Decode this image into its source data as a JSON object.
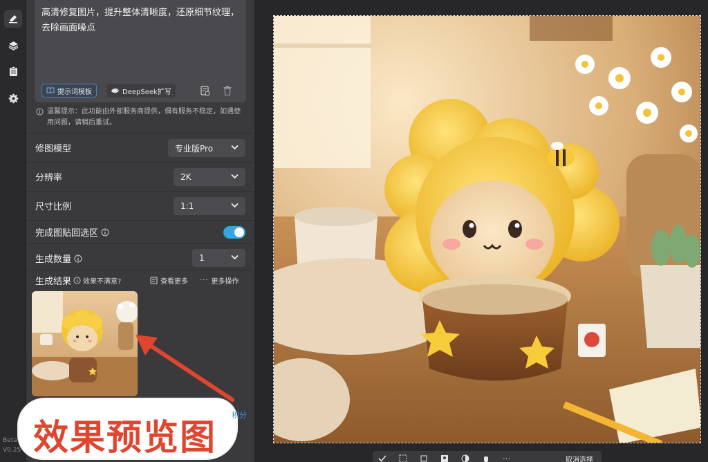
{
  "sidebar_rail": {
    "meta_line1": "Beta",
    "meta_line2": "V0.25"
  },
  "prompt": {
    "text": "高清修复图片，提升整体清晰度，还原细节纹理，去除画面噪点",
    "template_button": "提示词模板",
    "deepseek_button": "DeepSeek扩写"
  },
  "tip": "温馨提示：此功能由外部服务商提供，偶有服务不稳定，如遇使用问题，请稍后重试。",
  "settings": {
    "model": {
      "label": "修图模型",
      "value": "专业版Pro"
    },
    "resolution": {
      "label": "分辨率",
      "value": "2K"
    },
    "ratio": {
      "label": "尺寸比例",
      "value": "1:1"
    },
    "paste_back": {
      "label": "完成图贴回选区",
      "enabled": true
    },
    "count": {
      "label": "生成数量",
      "value": "1"
    }
  },
  "results": {
    "title": "生成结果",
    "unsatisfied": "效果不满意?",
    "view_more": "查看更多",
    "more_actions": "更多操作"
  },
  "overlay": {
    "caption": "效果预览图",
    "points_fragment": "积分"
  },
  "canvas_toolbar": {
    "cancel_selection": "取消选择"
  },
  "colors": {
    "accent_blue": "#2f8de9",
    "toggle_on": "#2fa8e0",
    "annotation_red": "#e0452f"
  }
}
